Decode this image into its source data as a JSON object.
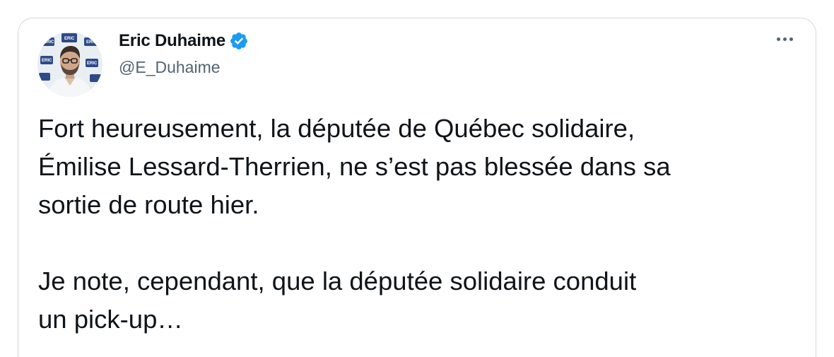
{
  "author": {
    "name": "Eric Duhaime",
    "handle": "@E_Duhaime",
    "verified": true,
    "avatar_icon": "avatar-photo",
    "avatar_backdrop_text": "ERIC"
  },
  "menu": {
    "icon": "more-options-icon"
  },
  "tweet": {
    "paragraphs": [
      "Fort heureusement, la députée de Québec solidaire,\nÉmilise Lessard-Therrien, ne s’est pas blessée dans sa\nsortie de route hier.",
      "Je note, cependant, que la députée solidaire conduit\nun pick-up…"
    ]
  },
  "colors": {
    "text_primary": "#0f1419",
    "text_secondary": "#536471",
    "border": "#cfd9de",
    "verified_blue": "#1d9bf0"
  }
}
